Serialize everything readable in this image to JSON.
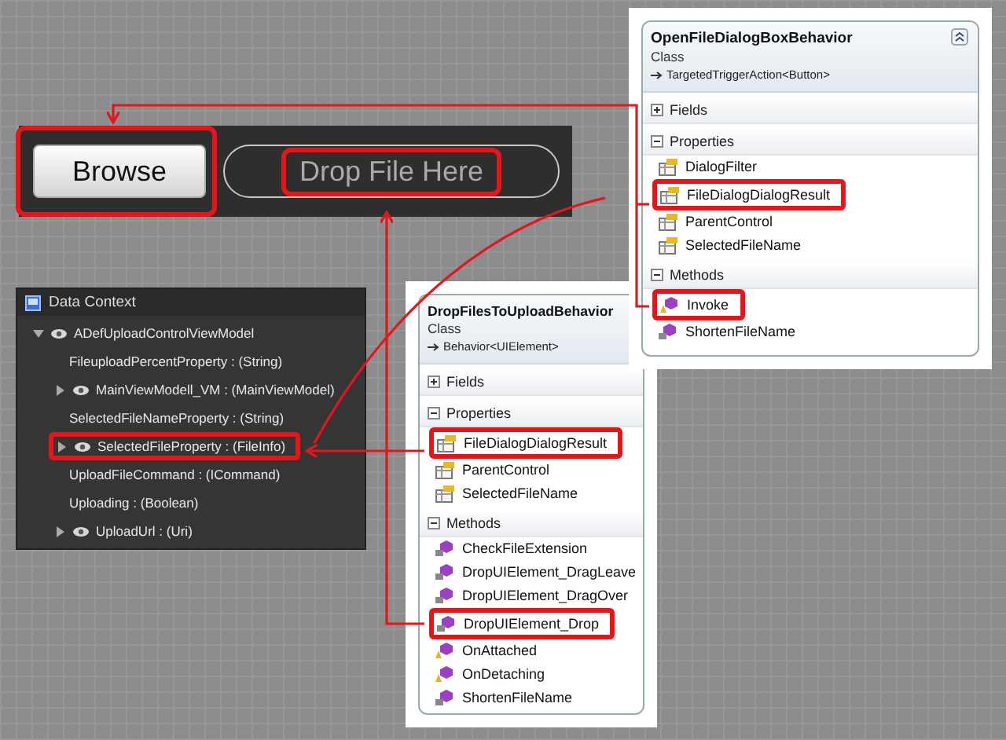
{
  "upload_control": {
    "browse_button": {
      "label": "Browse",
      "highlighted": true
    },
    "drop_zone": {
      "label": "Drop File Here",
      "highlighted": true
    }
  },
  "data_context": {
    "title": "Data Context",
    "items": [
      {
        "label": "ADefUploadControlViewModel",
        "kind": "object",
        "expanded": true,
        "highlighted": false,
        "children": [
          {
            "label": "FileuploadPercentProperty : (String)",
            "kind": "value",
            "highlighted": false
          },
          {
            "label": "MainViewModell_VM : (MainViewModel)",
            "kind": "object",
            "expanded": false,
            "highlighted": false
          },
          {
            "label": "SelectedFileNameProperty : (String)",
            "kind": "value",
            "highlighted": false
          },
          {
            "label": "SelectedFileProperty : (FileInfo)",
            "kind": "object",
            "expanded": false,
            "highlighted": true
          },
          {
            "label": "UploadFileCommand : (ICommand)",
            "kind": "value",
            "highlighted": false
          },
          {
            "label": "Uploading : (Boolean)",
            "kind": "value",
            "highlighted": false
          },
          {
            "label": "UploadUrl : (Uri)",
            "kind": "object",
            "expanded": false,
            "highlighted": false
          }
        ]
      }
    ]
  },
  "classes": [
    {
      "name": "DropFilesToUploadBehavior",
      "type": "Class",
      "base": "Behavior<UIElement>",
      "collapse_button": false,
      "sections": [
        {
          "title": "Fields",
          "expanded": false
        },
        {
          "title": "Properties",
          "expanded": true,
          "members": [
            {
              "name": "FileDialogDialogResult",
              "kind": "property",
              "highlighted": true
            },
            {
              "name": "ParentControl",
              "kind": "property",
              "highlighted": false
            },
            {
              "name": "SelectedFileName",
              "kind": "property",
              "highlighted": false
            }
          ]
        },
        {
          "title": "Methods",
          "expanded": true,
          "members": [
            {
              "name": "CheckFileExtension",
              "kind": "private",
              "highlighted": false
            },
            {
              "name": "DropUIElement_DragLeave",
              "kind": "private",
              "highlighted": false
            },
            {
              "name": "DropUIElement_DragOver",
              "kind": "private",
              "highlighted": false
            },
            {
              "name": "DropUIElement_Drop",
              "kind": "private",
              "highlighted": true
            },
            {
              "name": "OnAttached",
              "kind": "protected",
              "highlighted": false
            },
            {
              "name": "OnDetaching",
              "kind": "protected",
              "highlighted": false
            },
            {
              "name": "ShortenFileName",
              "kind": "private",
              "highlighted": false
            }
          ]
        }
      ]
    },
    {
      "name": "OpenFileDialogBoxBehavior",
      "type": "Class",
      "base": "TargetedTriggerAction<Button>",
      "collapse_button": true,
      "sections": [
        {
          "title": "Fields",
          "expanded": false
        },
        {
          "title": "Properties",
          "expanded": true,
          "members": [
            {
              "name": "DialogFilter",
              "kind": "property",
              "highlighted": false
            },
            {
              "name": "FileDialogDialogResult",
              "kind": "property",
              "highlighted": true
            },
            {
              "name": "ParentControl",
              "kind": "property",
              "highlighted": false
            },
            {
              "name": "SelectedFileName",
              "kind": "property",
              "highlighted": false
            }
          ]
        },
        {
          "title": "Methods",
          "expanded": true,
          "members": [
            {
              "name": "Invoke",
              "kind": "protected",
              "highlighted": true
            },
            {
              "name": "ShortenFileName",
              "kind": "private",
              "highlighted": false
            }
          ]
        }
      ]
    }
  ]
}
